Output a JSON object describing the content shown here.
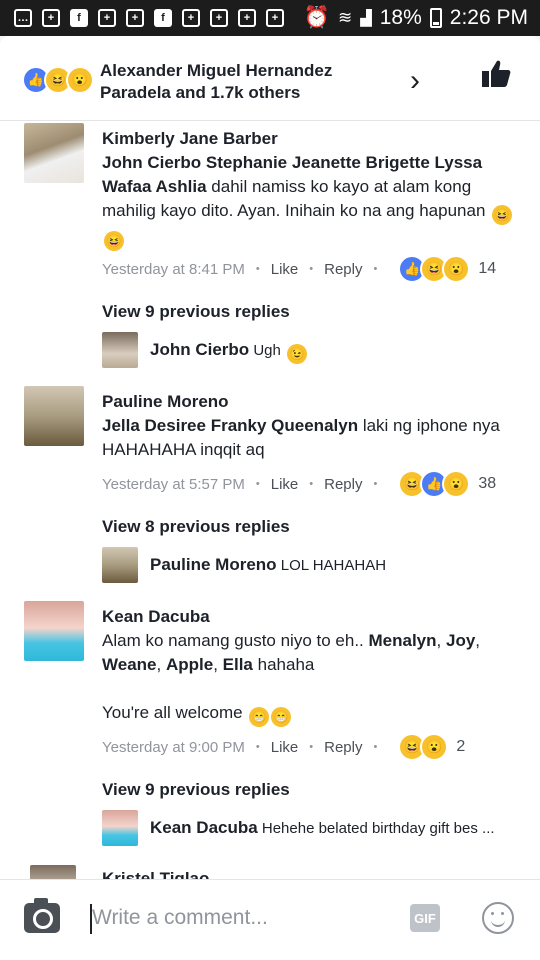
{
  "status": {
    "battery_pct": "18%",
    "time": "2:26 PM"
  },
  "header": {
    "text": "Alexander Miguel Hernandez Paradela and 1.7k others"
  },
  "comments": [
    {
      "author": "Kimberly Jane Barber",
      "tags": "John Cierbo Stephanie Jeanette Brigette Lyssa Wafaa Ashlia",
      "text": "dahil namiss ko kayo at alam kong mahilig kayo dito. Ayan. Inihain ko na ang hapunan",
      "time": "Yesterday at 8:41 PM",
      "like": "Like",
      "reply": "Reply",
      "count": "14",
      "view_prev": "View 9 previous replies",
      "reply_author": "John Cierbo",
      "reply_text": "Ugh"
    },
    {
      "author": "Pauline Moreno",
      "tags": "Jella Desiree Franky Queenalyn",
      "text": "laki ng iphone nya HAHAHAHA inqqit aq",
      "time": "Yesterday at 5:57 PM",
      "like": "Like",
      "reply": "Reply",
      "count": "38",
      "view_prev": "View 8 previous replies",
      "reply_author": "Pauline Moreno",
      "reply_text": "LOL HAHAHAH"
    },
    {
      "author": "Kean Dacuba",
      "text1": "Alam ko namang gusto niyo to eh..",
      "names": [
        "Menalyn",
        "Joy",
        "Weane",
        "Apple",
        "Ella"
      ],
      "text2": "hahaha",
      "text3": "You're all welcome",
      "time": "Yesterday at 9:00 PM",
      "like": "Like",
      "reply": "Reply",
      "count": "2",
      "view_prev": "View 9 previous replies",
      "reply_author": "Kean Dacuba",
      "reply_text": "Hehehe belated birthday gift bes ..."
    },
    {
      "author": "Kristel Tiglao"
    }
  ],
  "composer": {
    "placeholder": "Write a comment...",
    "gif_label": "GIF"
  }
}
